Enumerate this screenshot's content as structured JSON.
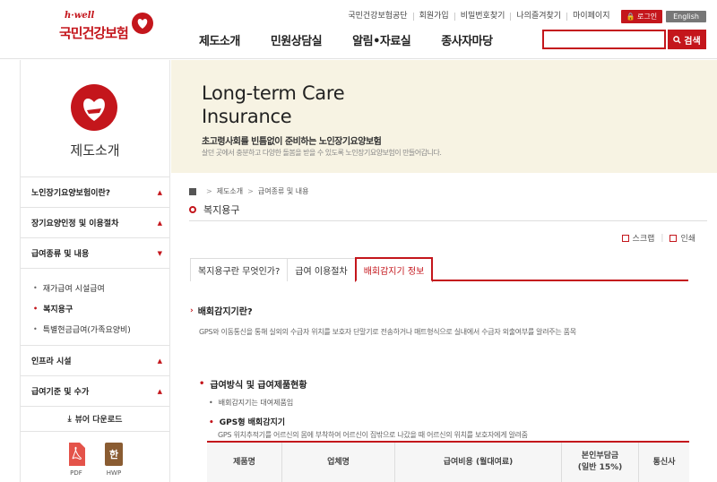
{
  "header": {
    "logo_small": "h·well",
    "logo_name": "국민건강보험",
    "util_links": [
      "국민건강보험공단",
      "회원가입",
      "비밀번호찾기",
      "나의즐겨찾기",
      "마이페이지"
    ],
    "login": "로그인",
    "english": "English",
    "gnb": [
      "제도소개",
      "민원상담실",
      "알림•자료실",
      "종사자마당"
    ],
    "search_placeholder": "",
    "search_label": "검색"
  },
  "sidebar": {
    "title": "제도소개",
    "menu": [
      {
        "label": "노인장기요양보험이란?",
        "arrow": "▲"
      },
      {
        "label": "장기요양인정 및 이용절차",
        "arrow": "▲"
      },
      {
        "label": "급여종류 및 내용",
        "arrow": "▼"
      }
    ],
    "sub": [
      "재가급여 시설급여",
      "복지용구",
      "특별현금급여(가족요양비)"
    ],
    "menu2": [
      {
        "label": "인프라 시설",
        "arrow": "▲"
      },
      {
        "label": "급여기준 및 수가",
        "arrow": "▲"
      }
    ],
    "viewer": "뷰어 다운로드",
    "files": [
      "PDF",
      "HWP"
    ],
    "hwp_glyph": "한"
  },
  "banner": {
    "line1": "Long-term Care",
    "line2": "Insurance",
    "kr": "초고령사회를 빈틈없이 준비하는 노인장기요양보험",
    "kr_sub": "살던 곳에서 충분하고 다양한 돌봄을 받을 수 있도록 노인장기요양보험이 만들어갑니다."
  },
  "content": {
    "breadcrumb": [
      "제도소개",
      "급여종류 및 내용"
    ],
    "page_title": "복지용구",
    "tools": [
      "스크랩",
      "인쇄"
    ],
    "tabs": [
      "복지용구란 무엇인가?",
      "급여 이용절차",
      "배회감지기 정보"
    ],
    "h3": "배회감지기란?",
    "desc": "GPS와 이동통신을 통해 실외의 수급자 위치를 보호자 단말기로 전송하거나 매트형식으로 실내에서 수급자 외출여부를 알려주는 품목",
    "h4": "급여방식 및 급여제품현황",
    "li1": "배회감지기는 대여제품임",
    "li2": "GPS형 배회감지기",
    "li2_desc": "GPS 위치추적기를 어르신의 몸에 부착하여 어르신이 집밖으로 나갔을 때 어르신의 위치를 보호자에게 알려줌",
    "table_headers": [
      "제품명",
      "업체명",
      "급여비용 (월대여료)",
      "본인부담금\n(일반 15%)",
      "통신사"
    ]
  },
  "colors": {
    "accent": "#c4161c",
    "banner_bg": "#f7f3e3"
  }
}
